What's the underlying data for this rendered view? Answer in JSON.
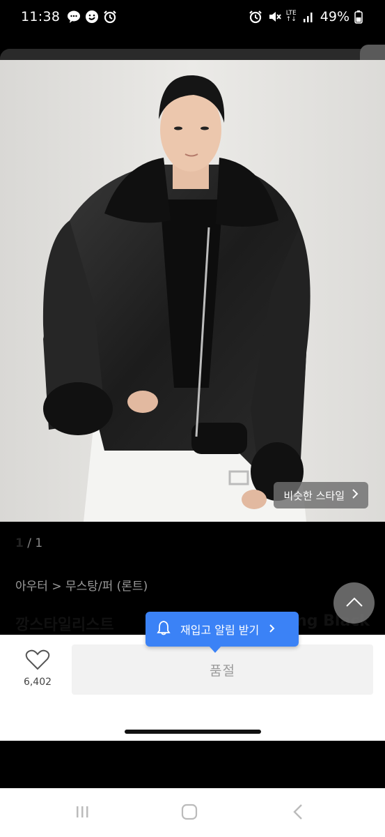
{
  "status_bar": {
    "time": "11:38",
    "battery_text": "49%",
    "network_label": "LTE",
    "left_icons": [
      "chat-bubble-icon",
      "messenger-icon",
      "alarm-icon"
    ],
    "right_icons": [
      "alarm-icon",
      "mute-icon",
      "lte-icon",
      "signal-icon",
      "battery-icon"
    ]
  },
  "product": {
    "image_counter_current": "1",
    "image_counter_sep": "/",
    "image_counter_total": "1",
    "similar_style_label": "비슷한 스타일",
    "breadcrumb": "아우터 > 무스탕/퍼 (론트)",
    "title_start": "깡스타일리스트",
    "title_end": "ng Black"
  },
  "restock_tooltip": {
    "label": "재입고 알림 받기"
  },
  "actions": {
    "like_count": "6,402",
    "soldout_label": "품절"
  },
  "colors": {
    "accent_blue": "#3b82f6",
    "soldout_bg": "#f2f2f2",
    "breadcrumb_gray": "#9a9a9a"
  }
}
